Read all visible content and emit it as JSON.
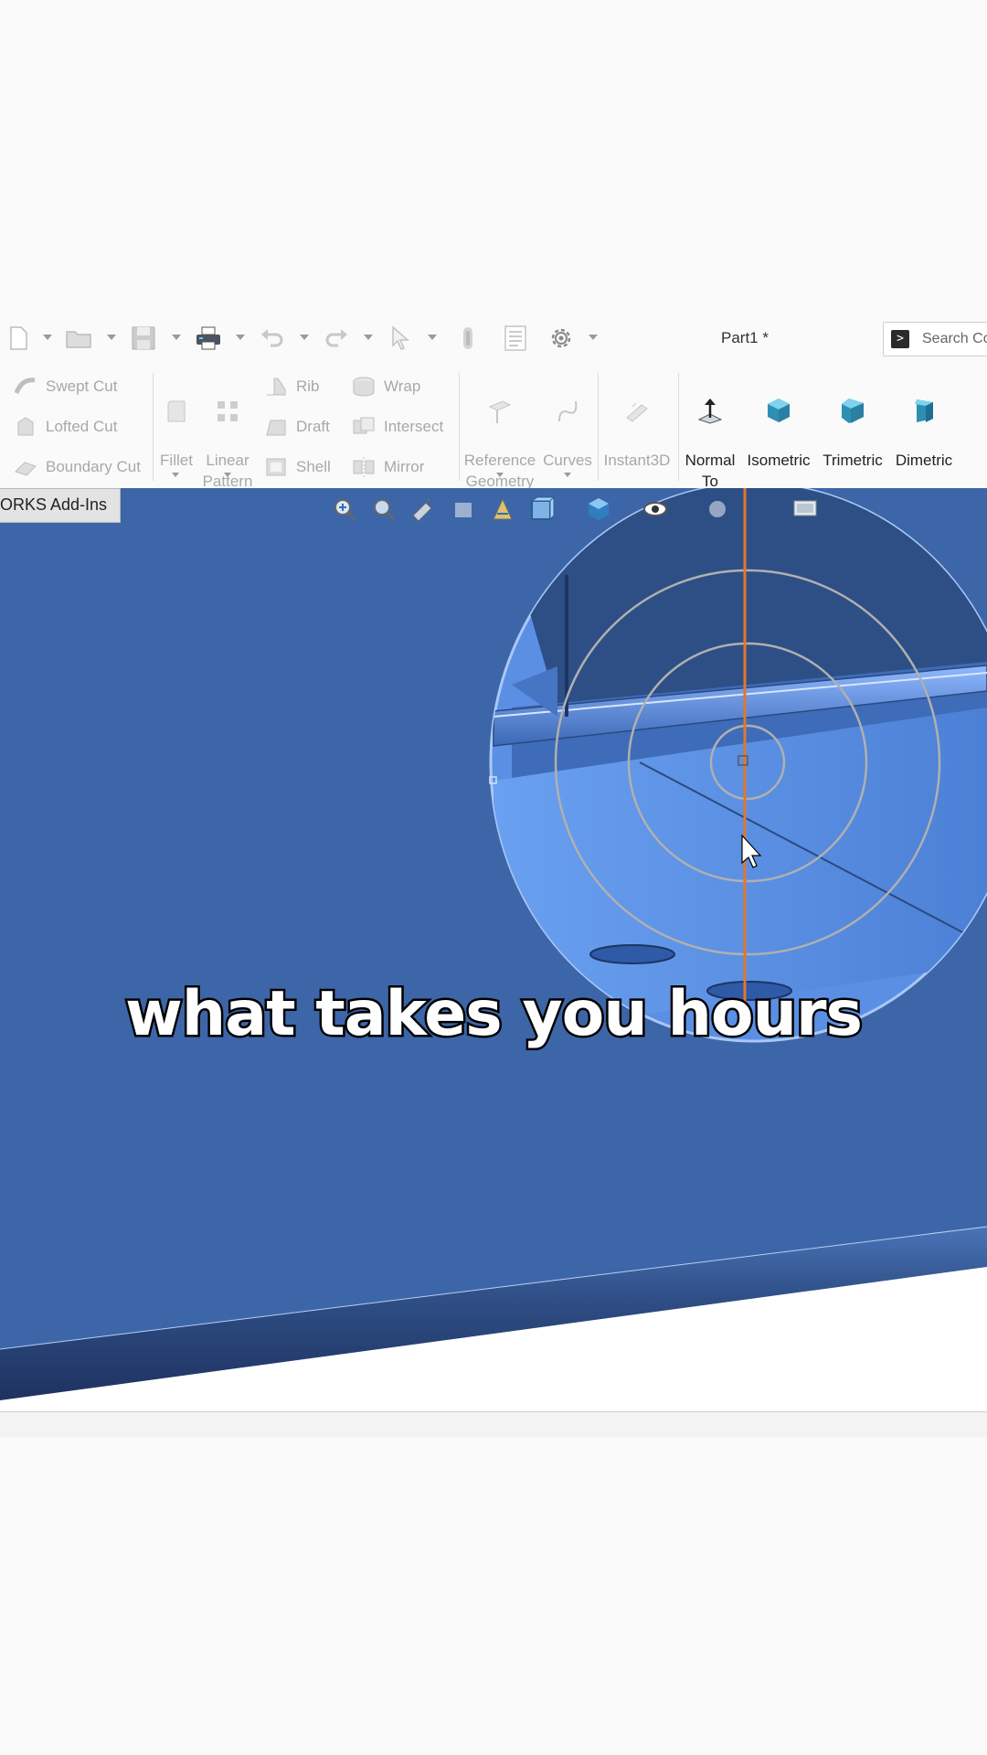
{
  "window": {
    "title": "Part1 *"
  },
  "search": {
    "placeholder": "Search Commands"
  },
  "ribbon": {
    "features": {
      "swept_cut": "Swept Cut",
      "lofted_cut": "Lofted Cut",
      "boundary_cut": "Boundary Cut",
      "fillet": "Fillet",
      "linear_pattern": "Linear\nPattern",
      "rib": "Rib",
      "draft": "Draft",
      "shell": "Shell",
      "wrap": "Wrap",
      "intersect": "Intersect",
      "mirror": "Mirror",
      "reference_geometry": "Reference\nGeometry",
      "curves": "Curves",
      "instant3d": "Instant3D"
    },
    "views": {
      "normal_to": "Normal\nTo",
      "isometric": "Isometric",
      "trimetric": "Trimetric",
      "dimetric": "Dimetric"
    }
  },
  "tabs": {
    "addins": "ORKS Add-Ins"
  },
  "caption": {
    "text": "what takes you hours"
  },
  "colors": {
    "model_blue": "#3d66a9",
    "model_light": "#5a8ee6",
    "sketch_orange": "#e0782d",
    "view_cube": "#3aa3c8"
  }
}
